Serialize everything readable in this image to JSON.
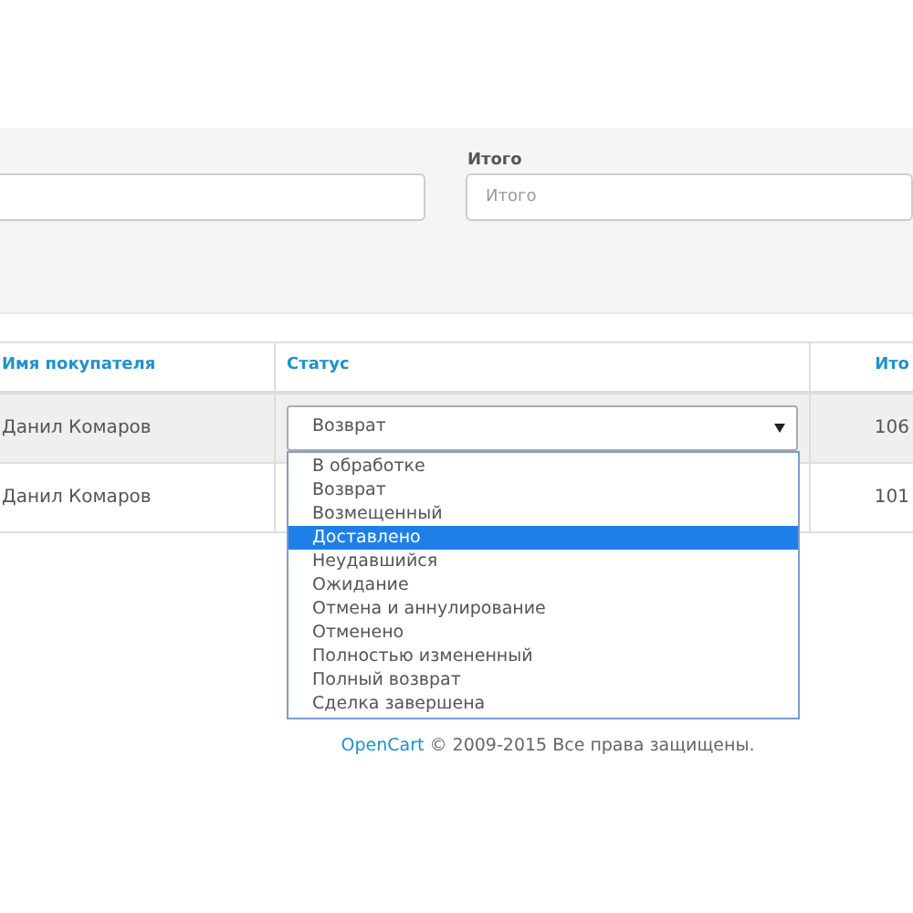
{
  "filter": {
    "total_label": "Итого",
    "total_placeholder": "Итого"
  },
  "table": {
    "columns": [
      "Имя покупателя",
      "Статус",
      "Ито"
    ],
    "rows": [
      {
        "customer": "Данил Комаров",
        "status": "Возврат",
        "column_3": "106",
        "hovered": true
      },
      {
        "customer": "Данил Комаров",
        "column_3": "101",
        "hovered": false
      }
    ]
  },
  "dropdown": {
    "options": [
      {
        "label": "В обработке",
        "selected": false
      },
      {
        "label": "Возврат",
        "selected": false
      },
      {
        "label": "Возмещенный",
        "selected": false
      },
      {
        "label": "Доставлено",
        "selected": true
      },
      {
        "label": "Неудавшийся",
        "selected": false
      },
      {
        "label": "Ожидание",
        "selected": false
      },
      {
        "label": "Отмена и аннулирование",
        "selected": false
      },
      {
        "label": "Отменено",
        "selected": false
      },
      {
        "label": "Полностью измененный",
        "selected": false
      },
      {
        "label": "Полный возврат",
        "selected": false
      },
      {
        "label": "Сделка завершена",
        "selected": false
      }
    ]
  },
  "footer": {
    "link": "OpenCart",
    "text": "© 2009-2015 Все права защищены."
  }
}
